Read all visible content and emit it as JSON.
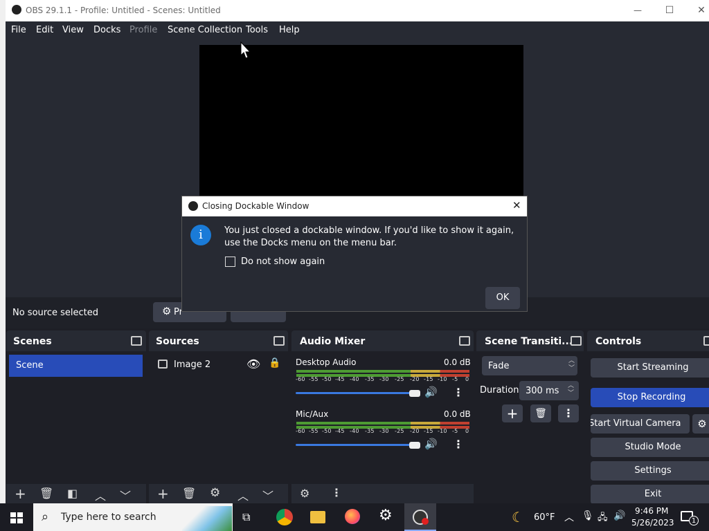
{
  "window": {
    "title": "OBS 29.1.1 - Profile: Untitled - Scenes: Untitled",
    "minimize": "—",
    "maximize": "☐",
    "close": "✕"
  },
  "menu": [
    "File",
    "Edit",
    "View",
    "Docks",
    "Profile",
    "Scene Collection",
    "Tools",
    "Help"
  ],
  "source_bar": {
    "no_source": "No source selected",
    "properties_label": "Pr"
  },
  "docks": {
    "scenes": {
      "title": "Scenes",
      "items": [
        "Scene"
      ]
    },
    "sources": {
      "title": "Sources",
      "items": [
        "Image 2"
      ]
    },
    "audio_mixer": {
      "title": "Audio Mixer",
      "channels": [
        {
          "name": "Desktop Audio",
          "level": "0.0 dB",
          "volume": 0.93
        },
        {
          "name": "Mic/Aux",
          "level": "0.0 dB",
          "volume": 0.93
        }
      ],
      "scale": [
        "-60",
        "-55",
        "-50",
        "-45",
        "-40",
        "-35",
        "-30",
        "-25",
        "-20",
        "-15",
        "-10",
        "-5",
        "0"
      ]
    },
    "transitions": {
      "title": "Scene Transiti...",
      "selected": "Fade",
      "duration_label": "Duration",
      "duration_value": "300 ms"
    },
    "controls": {
      "title": "Controls",
      "buttons": [
        "Start Streaming",
        "Stop Recording",
        "Start Virtual Camera",
        "Studio Mode",
        "Settings",
        "Exit"
      ]
    }
  },
  "dialog": {
    "title": "Closing Dockable Window",
    "message": "You just closed a dockable window. If you'd like to show it again, use the Docks menu on the menu bar.",
    "checkbox": "Do not show again",
    "ok": "OK"
  },
  "taskbar": {
    "search_placeholder": "Type here to search",
    "weather": "60°F",
    "time": "9:46 PM",
    "date": "5/26/2023",
    "notifications": "1"
  },
  "colors": {
    "accent": "#284cb8",
    "panel": "#272a33",
    "background": "#1e1f26"
  }
}
